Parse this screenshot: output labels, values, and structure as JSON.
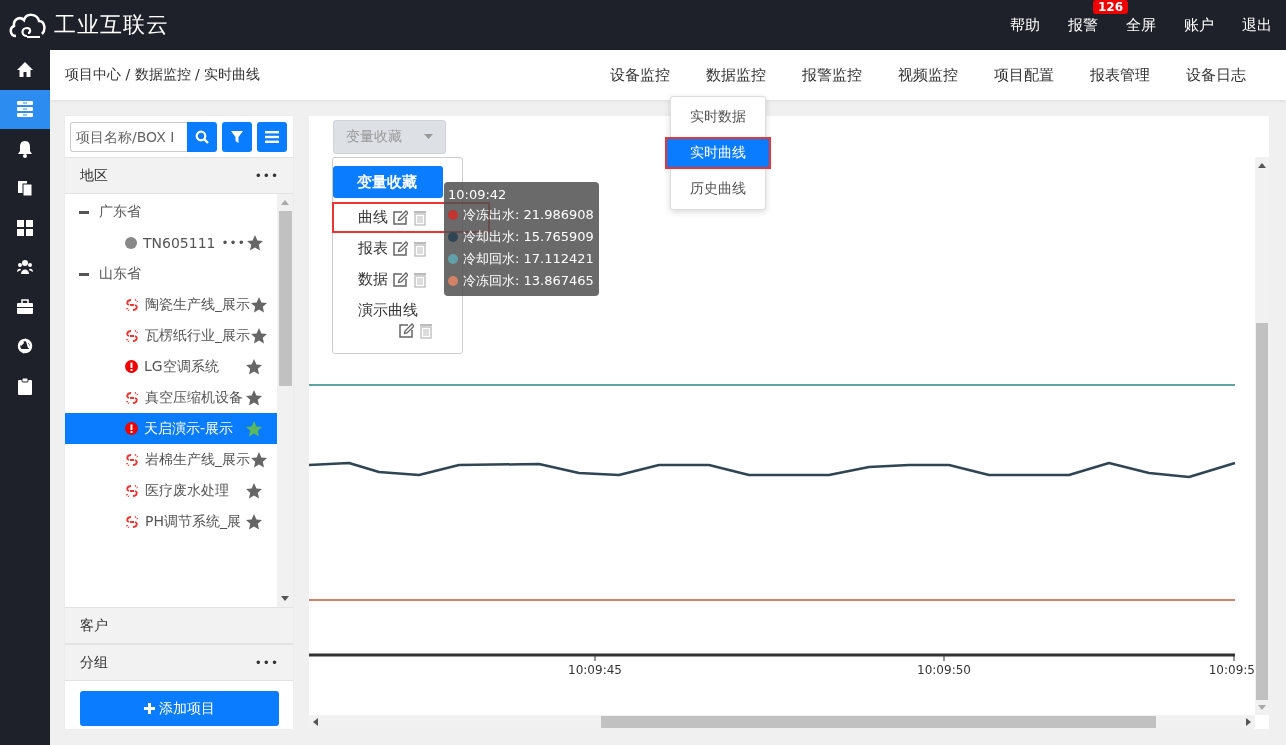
{
  "app": {
    "title": "工业互联云"
  },
  "topbar": {
    "items": [
      {
        "label": "帮助"
      },
      {
        "label": "报警",
        "badge": "126"
      },
      {
        "label": "全屏"
      },
      {
        "label": "账户"
      },
      {
        "label": "退出"
      }
    ]
  },
  "sidebar": {
    "items": [
      {
        "selected": false
      },
      {
        "selected": true
      },
      {
        "selected": false
      },
      {
        "selected": false
      },
      {
        "selected": false
      },
      {
        "selected": false
      },
      {
        "selected": false
      },
      {
        "selected": false
      },
      {
        "selected": false
      }
    ]
  },
  "breadcrumb": "项目中心 / 数据监控 / 实时曲线",
  "nav": {
    "items": [
      {
        "label": "设备监控"
      },
      {
        "label": "数据监控",
        "submenu": [
          {
            "label": "实时数据",
            "selected": false,
            "annotated": false
          },
          {
            "label": "实时曲线",
            "selected": true,
            "annotated": true
          },
          {
            "label": "历史曲线",
            "selected": false,
            "annotated": false
          }
        ]
      },
      {
        "label": "报警监控"
      },
      {
        "label": "视频监控"
      },
      {
        "label": "项目配置"
      },
      {
        "label": "报表管理"
      },
      {
        "label": "设备日志"
      }
    ]
  },
  "project_panel": {
    "search": {
      "placeholder": "项目名称/BOX I"
    },
    "sections": [
      {
        "title": "地区",
        "menu": "•••",
        "tree": [
          {
            "label": "广东省",
            "expanded": true,
            "children": [
              {
                "label": "TN605111",
                "kind": "device",
                "menu": "•••",
                "selected": false
              }
            ]
          },
          {
            "label": "山东省",
            "expanded": true,
            "children": [
              {
                "label": "陶瓷生产线_展示",
                "kind": "offline",
                "selected": false
              },
              {
                "label": "瓦楞纸行业_展示",
                "kind": "offline",
                "selected": false
              },
              {
                "label": "LG空调系统",
                "kind": "alarm",
                "selected": false
              },
              {
                "label": "真空压缩机设备",
                "kind": "offline",
                "selected": false
              },
              {
                "label": "天启演示-展示",
                "kind": "alarm",
                "selected": true
              },
              {
                "label": "岩棉生产线_展示",
                "kind": "offline",
                "selected": false
              },
              {
                "label": "医疗废水处理",
                "kind": "offline",
                "selected": false
              },
              {
                "label": "PH调节系统_展",
                "kind": "offline",
                "selected": false
              }
            ]
          }
        ]
      },
      {
        "title": "客户"
      },
      {
        "title": "分组",
        "menu": "•••"
      }
    ],
    "add_button": "添加项目"
  },
  "chart_panel": {
    "select": {
      "label": "变量收藏"
    },
    "favorites_menu": {
      "items": [
        {
          "label": "变量收藏",
          "kind": "header",
          "selected": true,
          "annotated": false
        },
        {
          "label": "曲线",
          "kind": "entry",
          "selected": false,
          "annotated": true
        },
        {
          "label": "报表",
          "kind": "entry",
          "selected": false,
          "annotated": false
        },
        {
          "label": "数据",
          "kind": "entry",
          "selected": false,
          "annotated": false
        },
        {
          "label": "演示曲线",
          "kind": "entry",
          "selected": false,
          "annotated": false
        }
      ]
    },
    "tooltip": {
      "time": "10:09:42",
      "rows": [
        {
          "label": "冷冻出水: 21.986908",
          "color": "#c23531"
        },
        {
          "label": "冷却出水: 15.765909",
          "color": "#2f4554"
        },
        {
          "label": "冷却回水: 17.112421",
          "color": "#61a0a8"
        },
        {
          "label": "冷冻回水: 13.867465",
          "color": "#d48265"
        }
      ]
    },
    "x_labels": [
      "10:09:45",
      "10:09:50",
      "10:09:5"
    ]
  }
}
